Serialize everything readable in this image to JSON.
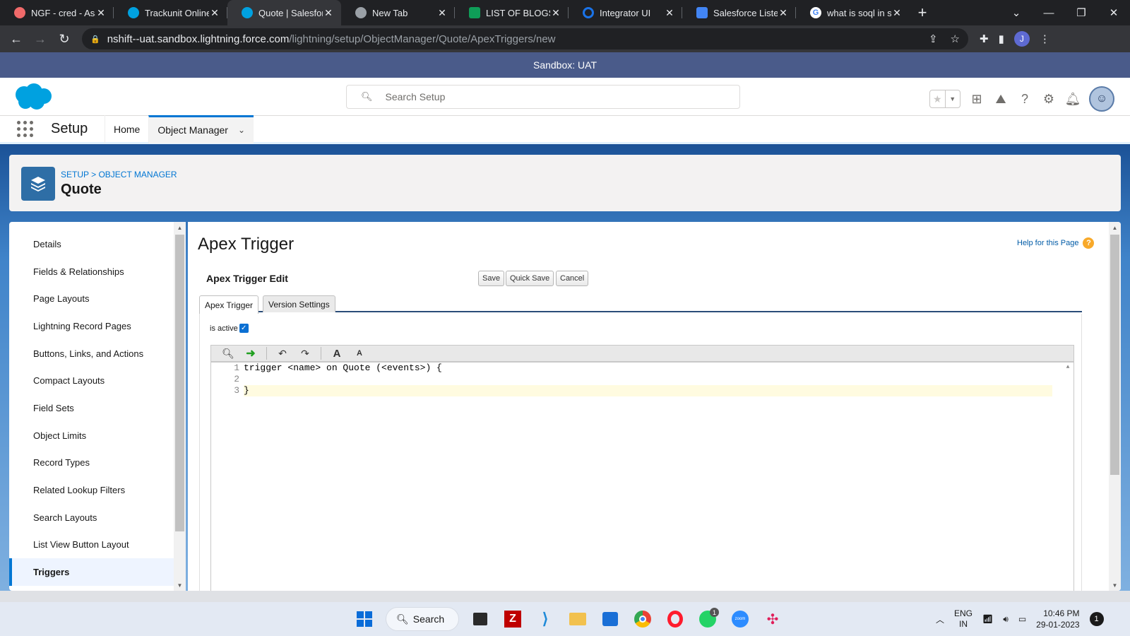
{
  "browser": {
    "tabs": [
      {
        "title": "NGF - cred - Asana",
        "favicon_color": "#f06a6a",
        "active": false
      },
      {
        "title": "Trackunit Online D",
        "favicon_color": "#00a1e0",
        "active": false
      },
      {
        "title": "Quote | Salesforce",
        "favicon_color": "#00a1e0",
        "active": true
      },
      {
        "title": "New Tab",
        "favicon_color": "#9aa0a6",
        "active": false
      },
      {
        "title": "LIST OF BLOGS - G",
        "favicon_color": "#0f9d58",
        "active": false
      },
      {
        "title": "Integrator UI",
        "favicon_color": "#1a73e8",
        "active": false
      },
      {
        "title": "Salesforce Listener",
        "favicon_color": "#4285f4",
        "active": false
      },
      {
        "title": "what is soql in sal",
        "favicon_color": "#ffffff",
        "active": false
      }
    ],
    "url_host": "nshift--uat.sandbox.lightning.force.com",
    "url_path": "/lightning/setup/ObjectManager/Quote/ApexTriggers/new",
    "profile_initial": "J"
  },
  "sandbox_banner": "Sandbox: UAT",
  "header": {
    "search_placeholder": "Search Setup"
  },
  "context_nav": {
    "app_name": "Setup",
    "items": [
      "Home",
      "Object Manager"
    ]
  },
  "page_header": {
    "breadcrumb": "SETUP > OBJECT MANAGER",
    "title": "Quote"
  },
  "sidebar": {
    "items": [
      "Details",
      "Fields & Relationships",
      "Page Layouts",
      "Lightning Record Pages",
      "Buttons, Links, and Actions",
      "Compact Layouts",
      "Field Sets",
      "Object Limits",
      "Record Types",
      "Related Lookup Filters",
      "Search Layouts",
      "List View Button Layout",
      "Triggers"
    ],
    "active_index": 12
  },
  "main": {
    "title": "Apex Trigger",
    "help_link": "Help for this Page",
    "edit_title": "Apex Trigger Edit",
    "buttons": {
      "save": "Save",
      "quick_save": "Quick Save",
      "cancel": "Cancel"
    },
    "tabs": [
      "Apex Trigger",
      "Version Settings"
    ],
    "is_active_label": "is active",
    "is_active_checked": true,
    "code_lines": [
      {
        "num": "1",
        "text": "trigger <name> on Quote (<events>) {"
      },
      {
        "num": "2",
        "text": ""
      },
      {
        "num": "3",
        "text": "}"
      }
    ]
  },
  "taskbar": {
    "search_label": "Search",
    "lang_line1": "ENG",
    "lang_line2": "IN",
    "time": "10:46 PM",
    "date": "29-01-2023",
    "notification_count": "1",
    "whatsapp_badge": "1"
  },
  "colors": {
    "brand_blue": "#0176d3",
    "sandbox_banner": "#4a5b8a",
    "object_icon": "#2e6ea6"
  }
}
